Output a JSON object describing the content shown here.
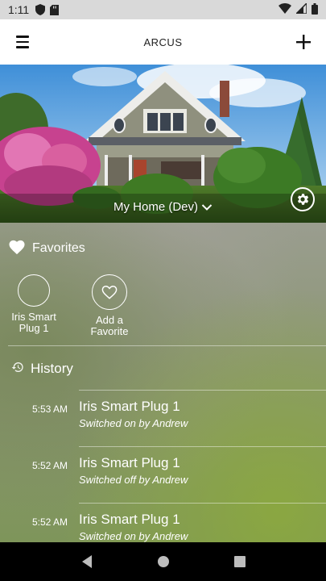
{
  "status_bar": {
    "time": "1:11",
    "icons": [
      "shield-icon",
      "sd-card-icon",
      "wifi-icon",
      "signal-icon",
      "battery-icon"
    ]
  },
  "app_bar": {
    "title": "ARCUS",
    "menu_icon": "hamburger-menu-icon",
    "add_icon": "plus-icon"
  },
  "hero": {
    "place_name": "My Home (Dev)",
    "settings_icon": "gear-icon"
  },
  "favorites": {
    "label": "Favorites",
    "items": [
      {
        "label": "Iris Smart\nPlug 1",
        "icon": "smart-plug-icon"
      },
      {
        "label": "Add a\nFavorite",
        "icon": "heart-outline-icon"
      }
    ]
  },
  "history": {
    "label": "History",
    "entries": [
      {
        "time": "5:53 AM",
        "device": "Iris Smart Plug 1",
        "event": "Switched on by Andrew"
      },
      {
        "time": "5:52 AM",
        "device": "Iris Smart Plug 1",
        "event": "Switched off by Andrew"
      },
      {
        "time": "5:52 AM",
        "device": "Iris Smart Plug 1",
        "event": "Switched on by Andrew"
      }
    ]
  },
  "nav_bar": {
    "icons": [
      "back-icon",
      "home-icon",
      "recents-icon"
    ]
  },
  "colors": {
    "app_bar_bg": "#ffffff",
    "status_bar_bg": "#d9d9d9",
    "nav_bar_bg": "#000000",
    "text_on_dashboard": "#ffffff"
  }
}
